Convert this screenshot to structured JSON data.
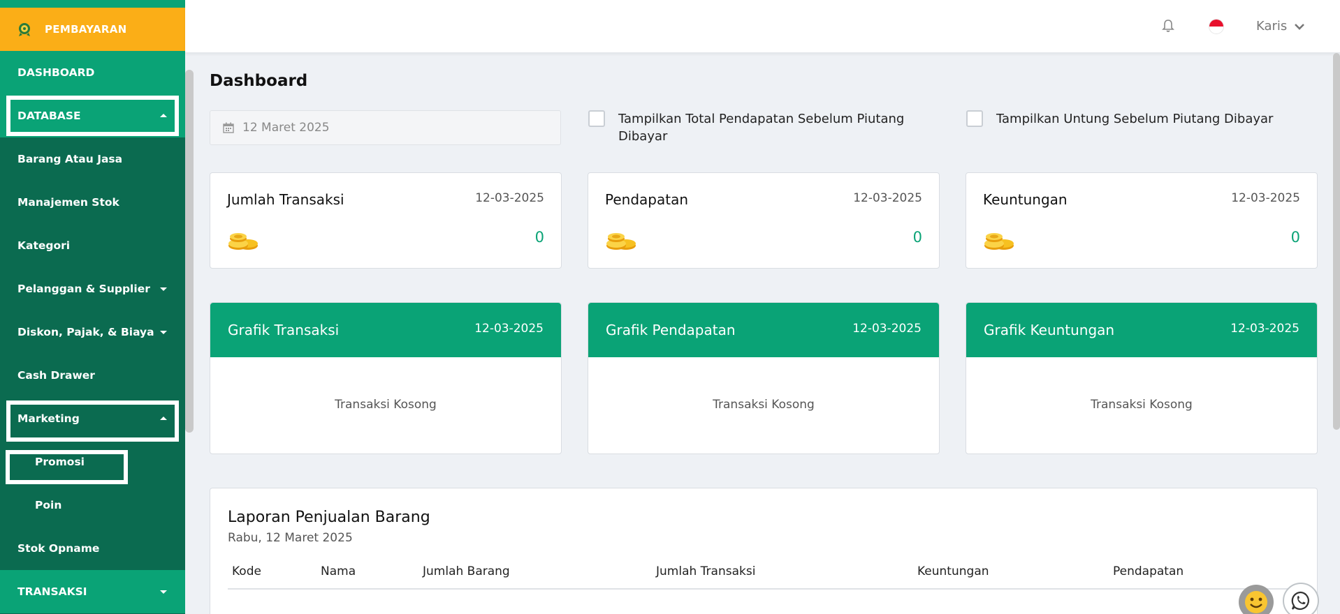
{
  "sidebar": {
    "brand": "PEMBAYARAN",
    "items": [
      {
        "label": "DASHBOARD"
      },
      {
        "label": "DATABASE"
      },
      {
        "label": "Barang Atau Jasa"
      },
      {
        "label": "Manajemen Stok"
      },
      {
        "label": "Kategori"
      },
      {
        "label": "Pelanggan & Supplier"
      },
      {
        "label": "Diskon, Pajak, & Biaya"
      },
      {
        "label": "Cash Drawer"
      },
      {
        "label": "Marketing"
      },
      {
        "label": "Promosi"
      },
      {
        "label": "Poin"
      },
      {
        "label": "Stok Opname"
      },
      {
        "label": "TRANSAKSI"
      }
    ]
  },
  "topbar": {
    "user_name": "Karis",
    "icons": [
      "bell-icon",
      "indonesia-flag-icon",
      "chevron-down-icon"
    ]
  },
  "main": {
    "title": "Dashboard",
    "date_value": "12 Maret 2025",
    "checkbox_pendapatan": "Tampilkan Total Pendapatan Sebelum Piutang Dibayar",
    "checkbox_untung": "Tampilkan Untung Sebelum Piutang Dibayar",
    "stats": [
      {
        "title": "Jumlah Transaksi",
        "date": "12-03-2025",
        "value": "0"
      },
      {
        "title": "Pendapatan",
        "date": "12-03-2025",
        "value": "0"
      },
      {
        "title": "Keuntungan",
        "date": "12-03-2025",
        "value": "0"
      }
    ],
    "charts": [
      {
        "title": "Grafik Transaksi",
        "date": "12-03-2025",
        "empty": "Transaksi Kosong"
      },
      {
        "title": "Grafik Pendapatan",
        "date": "12-03-2025",
        "empty": "Transaksi Kosong"
      },
      {
        "title": "Grafik Keuntungan",
        "date": "12-03-2025",
        "empty": "Transaksi Kosong"
      }
    ],
    "report": {
      "title": "Laporan Penjualan Barang",
      "subtitle": "Rabu, 12 Maret 2025",
      "columns": [
        "Kode",
        "Nama",
        "Jumlah Barang",
        "Jumlah Transaksi",
        "Keuntungan",
        "Pendapatan"
      ]
    }
  },
  "colors": {
    "brand_orange": "#fbae17",
    "sidebar_green": "#0b6b50",
    "accent_green": "#0aa376"
  }
}
